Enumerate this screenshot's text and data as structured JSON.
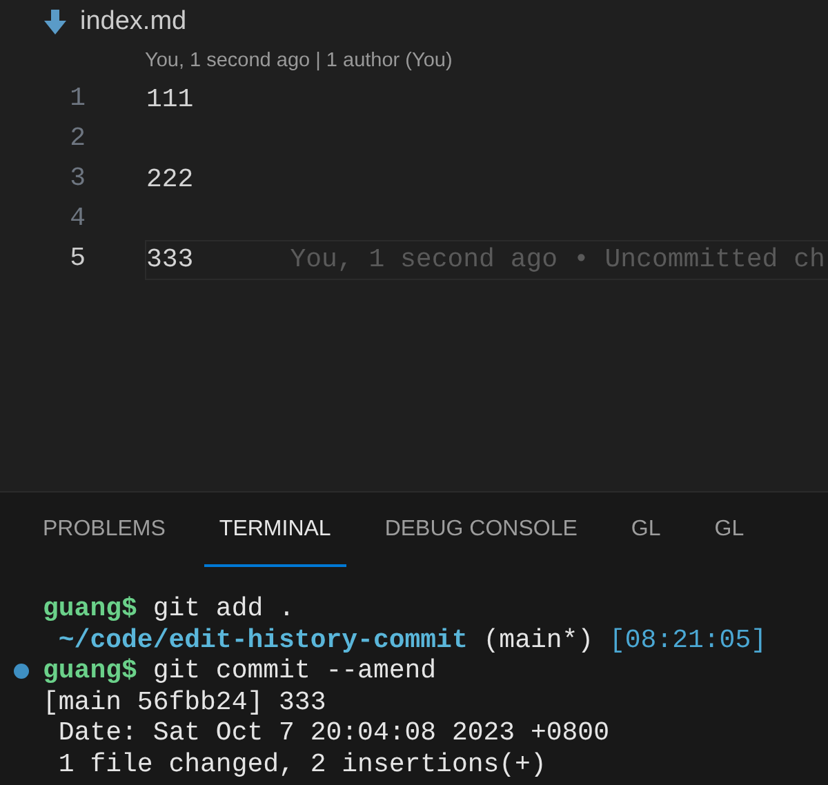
{
  "breadcrumb": {
    "file": "index.md"
  },
  "codelens": "You, 1 second ago | 1 author (You)",
  "editor_lines": [
    {
      "number": "1",
      "text": "111",
      "current": false
    },
    {
      "number": "2",
      "current": false
    },
    {
      "number": "3",
      "text": "222",
      "current": false
    },
    {
      "number": "4",
      "current": false
    },
    {
      "number": "5",
      "text": "333",
      "current": true,
      "blame": "You, 1 second ago • Uncommitted ch"
    }
  ],
  "panel_tabs": [
    {
      "label": "PROBLEMS",
      "selected": false
    },
    {
      "label": "TERMINAL",
      "selected": true
    },
    {
      "label": "DEBUG CONSOLE",
      "selected": false
    },
    {
      "label": "GL",
      "selected": false
    },
    {
      "label": "GL",
      "selected": false
    }
  ],
  "terminal_lines": [
    {
      "marked": false,
      "segments": [
        {
          "kind": "prompt",
          "text": "guang$"
        },
        {
          "kind": "plain",
          "text": " git add ."
        }
      ]
    },
    {
      "marked": false,
      "segments": [
        {
          "kind": "path",
          "text": " ~/code/edit-history-commit"
        },
        {
          "kind": "plain",
          "text": " (main*) "
        },
        {
          "kind": "time",
          "text": "[08:21:05]"
        }
      ]
    },
    {
      "marked": true,
      "segments": [
        {
          "kind": "prompt",
          "text": "guang$"
        },
        {
          "kind": "plain",
          "text": " git commit --amend"
        }
      ]
    },
    {
      "marked": false,
      "segments": [
        {
          "kind": "plain",
          "text": "[main 56fbb24] 333"
        }
      ]
    },
    {
      "marked": false,
      "segments": [
        {
          "kind": "plain",
          "text": " Date: Sat Oct 7 20:04:08 2023 +0800"
        }
      ]
    },
    {
      "marked": false,
      "segments": [
        {
          "kind": "plain",
          "text": " 1 file changed, 2 insertions(+)"
        }
      ]
    }
  ]
}
